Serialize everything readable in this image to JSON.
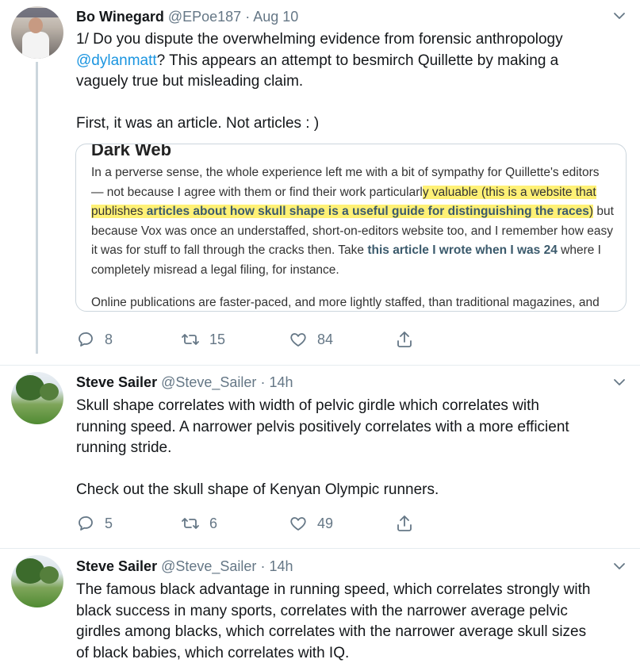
{
  "tweets": [
    {
      "name": "Bo Winegard",
      "handle": "@EPoe187",
      "time": "Aug 10",
      "text_line1_prefix": "1/ Do you dispute the overwhelming evidence from forensic anthropology",
      "mention": "@dylanmatt",
      "text_line2_suffix": "? This appears an attempt to besmirch Quillette by making a",
      "text_line3": "vaguely true but misleading claim.",
      "text_para2": "First, it was an article. Not articles : )",
      "card": {
        "heading": "Dark Web",
        "p1_a": "In a perverse sense, the whole experience left me with a bit of sympathy for Quillette's editors — not because I agree with them or find their work particularl",
        "p1_hl_a": "y valuable (this is a website that publishes ",
        "p1_hl_bold": "articles about how skull shape is a useful guide for distinguishing the races",
        "p1_hl_b": ")",
        "p1_b": " but because Vox was once an understaffed, short-on-editors website too, and I remember how easy it was for stuff to fall through the cracks then. Take ",
        "p1_link": "this article I wrote when I was 24",
        "p1_c": " where I completely misread a legal filing, for instance.",
        "p2": "Online publications are faster-paced, and more lightly staffed, than traditional magazines, and"
      },
      "replies": "8",
      "retweets": "15",
      "likes": "84"
    },
    {
      "name": "Steve Sailer",
      "handle": "@Steve_Sailer",
      "time": "14h",
      "lines": [
        "Skull shape correlates with width of pelvic girdle which correlates with",
        "running speed. A narrower pelvis positively correlates with a more efficient",
        "running stride."
      ],
      "para2": "Check out the skull shape of Kenyan Olympic runners.",
      "replies": "5",
      "retweets": "6",
      "likes": "49"
    },
    {
      "name": "Steve Sailer",
      "handle": "@Steve_Sailer",
      "time": "14h",
      "lines": [
        "The famous black advantage in running speed, which correlates strongly with",
        "black success in many sports, correlates with the narrower average pelvic",
        "girdles among blacks, which correlates with the narrower average skull sizes",
        "of black babies, which correlates with IQ."
      ]
    }
  ],
  "separator": "·",
  "icons": {
    "reply": "reply-icon",
    "retweet": "retweet-icon",
    "like": "heart-icon",
    "share": "share-icon",
    "menu": "chevron-down-icon"
  },
  "colors": {
    "link": "#1b95e0",
    "secondary": "#657786",
    "highlight": "#fff176"
  }
}
